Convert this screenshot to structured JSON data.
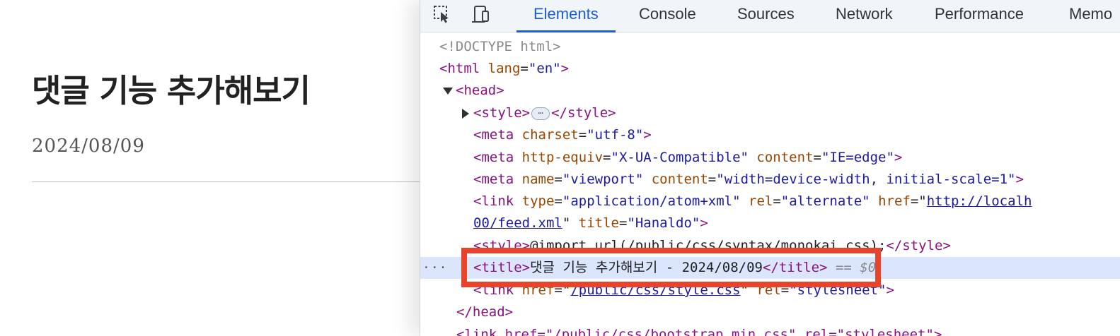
{
  "page": {
    "title": "댓글 기능 추가해보기",
    "date": "2024/08/09"
  },
  "devtools": {
    "tabs": [
      "Elements",
      "Console",
      "Sources",
      "Network",
      "Performance",
      "Memo"
    ],
    "active_tab": "Elements",
    "accent_color": "#1a5fd1",
    "tools": [
      "element-picker-icon",
      "device-toggle-icon"
    ],
    "dom": {
      "doctype": "<!DOCTYPE html>",
      "html_open": "<html",
      "html_lang_attr": "lang",
      "html_lang_val": "\"en\"",
      "head_open": "<head>",
      "style_open": "<style>",
      "style_collapsed": "⋯",
      "style_close": "</style>",
      "meta1_tag": "<meta",
      "meta1_attr": "charset",
      "meta1_val": "\"utf-8\"",
      "meta2_tag": "<meta",
      "meta2_attr1": "http-equiv",
      "meta2_val1": "\"X-UA-Compatible\"",
      "meta2_attr2": "content",
      "meta2_val2": "\"IE=edge\"",
      "meta3_tag": "<meta",
      "meta3_attr1": "name",
      "meta3_val1": "\"viewport\"",
      "meta3_attr2": "content",
      "meta3_val2": "\"width=device-width, initial-scale=1\"",
      "link1_tag": "<link",
      "link1_attr1": "type",
      "link1_val1": "\"application/atom+xml\"",
      "link1_attr2": "rel",
      "link1_val2": "\"alternate\"",
      "link1_attr3": "href",
      "link1_href_a": "http://localh",
      "link1_href_b": "00/feed.xml",
      "link1_attr4": "title",
      "link1_val4": "\"Hanaldo\"",
      "style2_open": "<style>",
      "style2_text": "@import url(/public/css/syntax/monokai.css);",
      "style2_close": "</style>",
      "title_open": "<title>",
      "title_text": "댓글 기능 추가해보기 - 2024/08/09",
      "title_close": "</title>",
      "selected_marker": "== $0",
      "gutter_dots": "···",
      "link2_tag": "<link",
      "link2_attr1": "href",
      "link2_href": "/public/css/style.css",
      "link2_attr2": "rel",
      "link2_val2": "\"stylesheet\"",
      "head_close": "</head>",
      "last_line_partial": "<link href=\"/public/css/bootstrap.min.css\" rel=\"stylesheet\">"
    },
    "highlight_color": "#e8442c"
  }
}
